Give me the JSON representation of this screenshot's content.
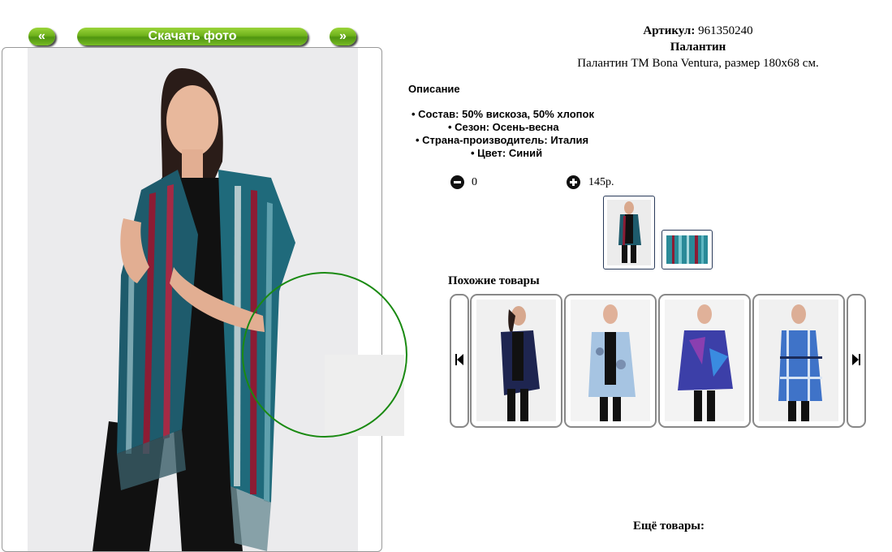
{
  "nav": {
    "prev_label": "«",
    "download_label": "Скачать фото",
    "next_label": "»"
  },
  "product": {
    "article_label": "Артикул:",
    "article_value": "961350240",
    "title": "Палантин",
    "subtitle": "Палантин ТМ Bona Ventura, размер 180х68 см."
  },
  "description": {
    "heading": "Описание",
    "specs": [
      "Состав: 50% вискоза, 50% хлопок",
      "Сезон: Осень-весна",
      "Страна-производитель: Италия",
      "Цвет: Синий"
    ]
  },
  "order": {
    "quantity": "0",
    "price": "145р."
  },
  "similar": {
    "heading": "Похожие товары",
    "items": [
      {
        "icon": "navy-scarf-product-photo"
      },
      {
        "icon": "light-blue-scarf-product-photo"
      },
      {
        "icon": "purple-blue-scarf-product-photo"
      },
      {
        "icon": "blue-plaid-scarf-product-photo"
      }
    ]
  },
  "more": {
    "heading": "Ещё товары:"
  },
  "colors": {
    "button_green": "#6fb21c",
    "magnifier_green": "#1a8a12",
    "card_border": "#888888"
  }
}
